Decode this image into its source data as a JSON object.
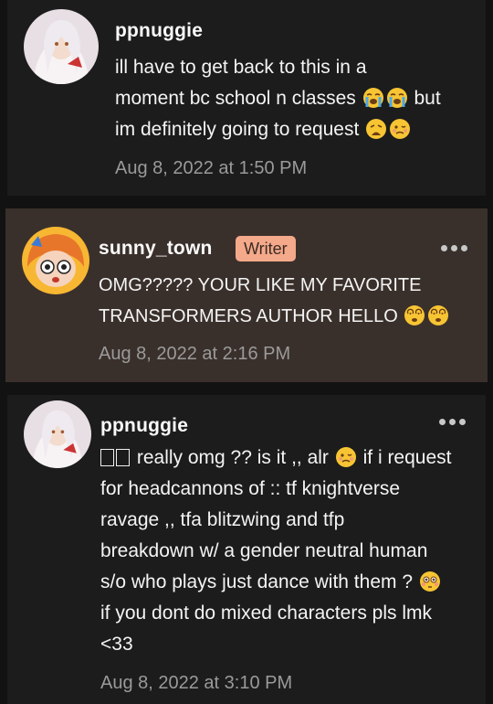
{
  "comments": [
    {
      "username": "ppnuggie",
      "lines": [
        "ill have to get back to this in a",
        "moment bc school n classes",
        "but",
        "im definitely going to request"
      ],
      "timestamp": "Aug 8, 2022 at 1:50 PM",
      "emojis": [
        "loudly-crying-face-emoji",
        "loudly-crying-face-emoji",
        "weary-face-emoji",
        "woozy-face-emoji"
      ]
    },
    {
      "username": "sunny_town",
      "badge": "Writer",
      "lines": [
        "OMG????? YOUR LIKE MY FAVORITE",
        "TRANSFORMERS AUTHOR HELLO"
      ],
      "timestamp": "Aug 8, 2022 at 2:16 PM",
      "emojis": [
        "dizzy-face-emoji",
        "dizzy-face-emoji"
      ]
    },
    {
      "username": "ppnuggie",
      "lines": [
        "really omg ?? is it ,, alr",
        "if i request",
        "for headcannons of  ::  tf knightverse",
        "ravage ,, tfa blitzwing and tfp",
        "breakdown w/ a gender neutral human",
        "s/o who plays just dance with them ?",
        "if you dont do mixed characters pls lmk",
        "<33"
      ],
      "timestamp": "Aug 8, 2022 at 3:10 PM",
      "emojis": [
        "missing-glyph",
        "missing-glyph",
        "woozy-face-emoji",
        "flushed-face-emoji"
      ]
    }
  ]
}
